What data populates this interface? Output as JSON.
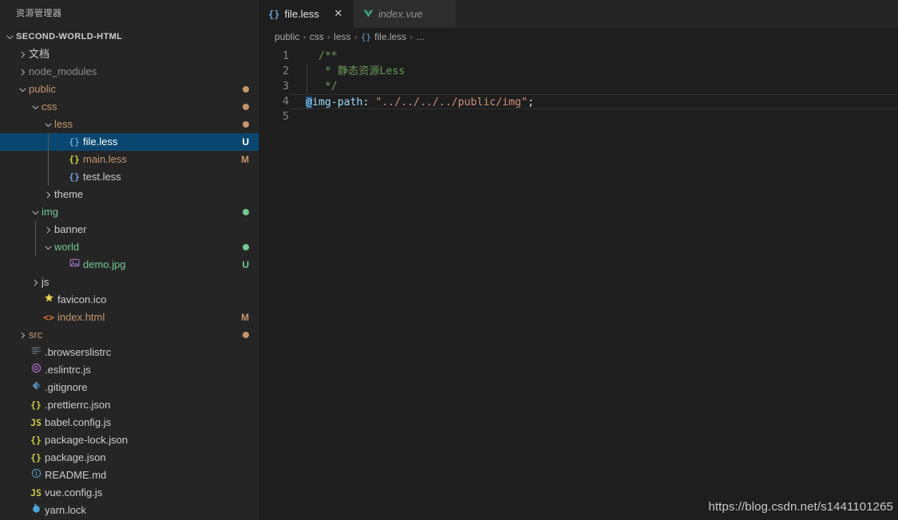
{
  "sidebar": {
    "title": "资源管理器",
    "root": {
      "label": "SECOND-WORLD-HTML",
      "twisty": "chevron-down-icon"
    },
    "items": [
      {
        "label": "文档",
        "indent": 1,
        "type": "folder",
        "twisty": "chevron-right-icon",
        "color": "c-white",
        "icon": "",
        "icon_color": "",
        "deco": "",
        "dot": ""
      },
      {
        "label": "node_modules",
        "indent": 1,
        "type": "folder",
        "twisty": "chevron-right-icon",
        "color": "c-dim",
        "icon": "",
        "icon_color": "",
        "deco": "",
        "dot": ""
      },
      {
        "label": "public",
        "indent": 1,
        "type": "folder",
        "twisty": "chevron-down-icon",
        "color": "c-modified",
        "icon": "",
        "icon_color": "",
        "deco": "",
        "dot": "#c5966c"
      },
      {
        "label": "css",
        "indent": 2,
        "type": "folder",
        "twisty": "chevron-down-icon",
        "color": "c-modified",
        "icon": "",
        "icon_color": "",
        "deco": "",
        "dot": "#c5966c"
      },
      {
        "label": "less",
        "indent": 3,
        "type": "folder",
        "twisty": "chevron-down-icon",
        "color": "c-modified",
        "icon": "",
        "icon_color": "",
        "deco": "",
        "dot": "#c5966c"
      },
      {
        "label": "file.less",
        "indent": 4,
        "type": "file",
        "twisty": "",
        "color": "c-sel",
        "icon": "{}",
        "icon_color": "c-jsonblue",
        "deco": "U",
        "deco_color": "#ffffff",
        "selected": true
      },
      {
        "label": "main.less",
        "indent": 4,
        "type": "file",
        "twisty": "",
        "color": "c-modified",
        "icon": "{}",
        "icon_color": "c-json",
        "deco": "M",
        "deco_color": "#c5966c"
      },
      {
        "label": "test.less",
        "indent": 4,
        "type": "file",
        "twisty": "",
        "color": "c-white",
        "icon": "{}",
        "icon_color": "c-jsonblue",
        "deco": "",
        "dot": ""
      },
      {
        "label": "theme",
        "indent": 3,
        "type": "folder",
        "twisty": "chevron-right-icon",
        "color": "c-white",
        "icon": "",
        "icon_color": "",
        "deco": "",
        "dot": ""
      },
      {
        "label": "img",
        "indent": 2,
        "type": "folder",
        "twisty": "chevron-down-icon",
        "color": "c-untrack",
        "icon": "",
        "icon_color": "",
        "deco": "",
        "dot": "#73c991"
      },
      {
        "label": "banner",
        "indent": 3,
        "type": "folder",
        "twisty": "chevron-right-icon",
        "color": "c-white",
        "icon": "",
        "icon_color": "",
        "deco": "",
        "dot": ""
      },
      {
        "label": "world",
        "indent": 3,
        "type": "folder",
        "twisty": "chevron-down-icon",
        "color": "c-untrack",
        "icon": "",
        "icon_color": "",
        "deco": "",
        "dot": "#73c991"
      },
      {
        "label": "demo.jpg",
        "indent": 4,
        "type": "file",
        "twisty": "",
        "color": "c-untrack",
        "icon": "image-icon",
        "icon_color": "c-img",
        "deco": "U",
        "deco_color": "#73c991"
      },
      {
        "label": "js",
        "indent": 2,
        "type": "folder",
        "twisty": "chevron-right-icon",
        "color": "c-white",
        "icon": "",
        "icon_color": "",
        "deco": "",
        "dot": ""
      },
      {
        "label": "favicon.ico",
        "indent": 2,
        "type": "file",
        "twisty": "",
        "color": "c-white",
        "icon": "star-icon",
        "icon_color": "c-star",
        "deco": "",
        "dot": ""
      },
      {
        "label": "index.html",
        "indent": 2,
        "type": "file",
        "twisty": "",
        "color": "c-modified",
        "icon": "<>",
        "icon_color": "c-html",
        "deco": "M",
        "deco_color": "#c5966c"
      },
      {
        "label": "src",
        "indent": 1,
        "type": "folder",
        "twisty": "chevron-right-icon",
        "color": "c-modified",
        "icon": "",
        "icon_color": "",
        "deco": "",
        "dot": "#c5966c"
      },
      {
        "label": ".browserslistrc",
        "indent": 1,
        "type": "file",
        "twisty": "",
        "color": "c-white",
        "icon": "list-icon",
        "icon_color": "c-list",
        "deco": "",
        "dot": ""
      },
      {
        "label": ".eslintrc.js",
        "indent": 1,
        "type": "file",
        "twisty": "",
        "color": "c-white",
        "icon": "eslint-icon",
        "icon_color": "c-lint",
        "deco": "",
        "dot": ""
      },
      {
        "label": ".gitignore",
        "indent": 1,
        "type": "file",
        "twisty": "",
        "color": "c-white",
        "icon": "git-icon",
        "icon_color": "c-git",
        "deco": "",
        "dot": ""
      },
      {
        "label": ".prettierrc.json",
        "indent": 1,
        "type": "file",
        "twisty": "",
        "color": "c-white",
        "icon": "{}",
        "icon_color": "c-json",
        "deco": "",
        "dot": ""
      },
      {
        "label": "babel.config.js",
        "indent": 1,
        "type": "file",
        "twisty": "",
        "color": "c-white",
        "icon": "JS",
        "icon_color": "c-js",
        "deco": "",
        "dot": ""
      },
      {
        "label": "package-lock.json",
        "indent": 1,
        "type": "file",
        "twisty": "",
        "color": "c-white",
        "icon": "{}",
        "icon_color": "c-json",
        "deco": "",
        "dot": ""
      },
      {
        "label": "package.json",
        "indent": 1,
        "type": "file",
        "twisty": "",
        "color": "c-white",
        "icon": "{}",
        "icon_color": "c-json",
        "deco": "",
        "dot": ""
      },
      {
        "label": "README.md",
        "indent": 1,
        "type": "file",
        "twisty": "",
        "color": "c-white",
        "icon": "info-icon",
        "icon_color": "c-md",
        "deco": "",
        "dot": ""
      },
      {
        "label": "vue.config.js",
        "indent": 1,
        "type": "file",
        "twisty": "",
        "color": "c-white",
        "icon": "JS",
        "icon_color": "c-js",
        "deco": "",
        "dot": ""
      },
      {
        "label": "yarn.lock",
        "indent": 1,
        "type": "file",
        "twisty": "",
        "color": "c-white",
        "icon": "yarn-icon",
        "icon_color": "c-yarn",
        "deco": "",
        "dot": ""
      }
    ]
  },
  "tabs": [
    {
      "label": "file.less",
      "icon": "{}",
      "icon_color": "#6a9fd4",
      "active": true,
      "italic": false,
      "close": "✕"
    },
    {
      "label": "index.vue",
      "icon": "vue-icon",
      "icon_color": "#41b883",
      "active": false,
      "italic": true,
      "close": ""
    }
  ],
  "breadcrumb": {
    "parts": [
      "public",
      "css",
      "less"
    ],
    "file": "file.less",
    "file_icon": "{}",
    "ellipsis": "...",
    "separator": "›"
  },
  "editor": {
    "line_numbers": [
      "1",
      "2",
      "3",
      "4",
      "5"
    ],
    "lines": [
      {
        "n": "1",
        "segments": [
          {
            "text": "  /**",
            "cls": "cmt"
          }
        ]
      },
      {
        "n": "2",
        "segments": [
          {
            "text": "   * 静态资源Less",
            "cls": "cmt"
          }
        ]
      },
      {
        "n": "3",
        "segments": [
          {
            "text": "   */",
            "cls": "cmt"
          }
        ]
      },
      {
        "n": "4",
        "segments": [
          {
            "text": "@",
            "cls": "varname sel-box"
          },
          {
            "text": "img-path",
            "cls": "varname"
          },
          {
            "text": ":",
            "cls": "punct"
          },
          {
            "text": " ",
            "cls": "punct"
          },
          {
            "text": "\"../../../../public/img\"",
            "cls": "str"
          },
          {
            "text": ";",
            "cls": "punct"
          }
        ]
      },
      {
        "n": "5",
        "segments": [
          {
            "text": "",
            "cls": "punct"
          }
        ]
      }
    ]
  },
  "watermark": "https://blog.csdn.net/s1441101265",
  "colors": {
    "selection": "#094771",
    "sidebar_bg": "#252526",
    "editor_bg": "#1e1e1e",
    "tab_inactive_bg": "#2d2d2d",
    "modified": "#c5966c",
    "untracked": "#73c991",
    "comment": "#6a9955",
    "string": "#ce9178",
    "variable": "#9cdcfe"
  }
}
